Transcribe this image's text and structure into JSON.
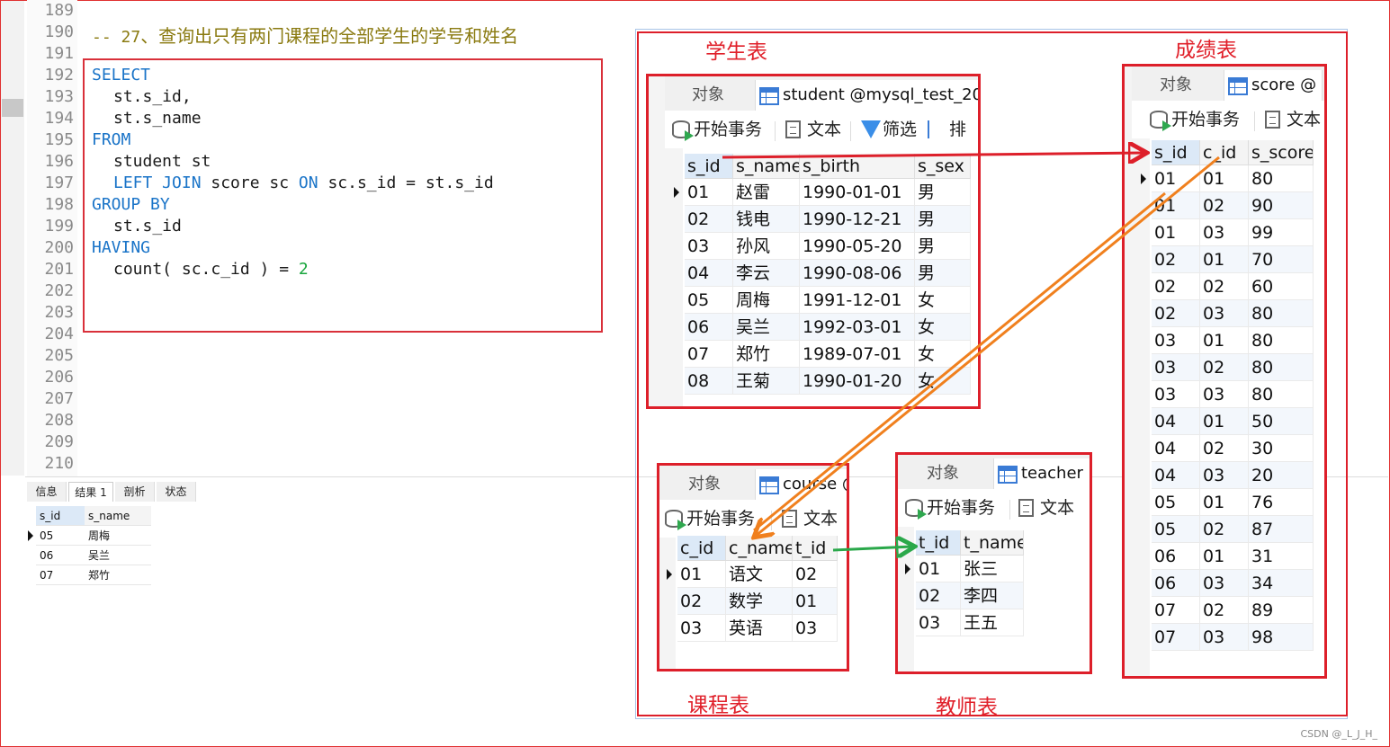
{
  "editor": {
    "line_numbers": [
      "189",
      "190",
      "191",
      "192",
      "193",
      "194",
      "195",
      "196",
      "197",
      "198",
      "199",
      "200",
      "201",
      "202",
      "203",
      "204",
      "205",
      "206",
      "207",
      "208",
      "209",
      "210"
    ],
    "comment_prefix": "-- 27",
    "comment_text": "、查询出只有两门课程的全部学生的学号和姓名",
    "sql": {
      "select": "SELECT",
      "col1": "st.s_id,",
      "col2": "st.s_name",
      "from": "FROM",
      "table": "student st",
      "left_join": "LEFT JOIN",
      "join_table": " score sc ",
      "on": "ON",
      "on_cond": " sc.s_id = st.s_id",
      "group_by": "GROUP BY",
      "group_col": "st.s_id",
      "having": "HAVING",
      "having_expr": "count( sc.c_id ) = ",
      "having_value": "2"
    }
  },
  "results": {
    "tabs": [
      "信息",
      "结果 1",
      "剖析",
      "状态"
    ],
    "active_tab": "结果 1",
    "columns": [
      "s_id",
      "s_name"
    ],
    "rows": [
      [
        "05",
        "周梅"
      ],
      [
        "06",
        "吴兰"
      ],
      [
        "07",
        "郑竹"
      ]
    ]
  },
  "labels": {
    "student": "学生表",
    "score": "成绩表",
    "course": "课程表",
    "teacher": "教师表"
  },
  "common": {
    "objects_tab": "对象",
    "begin_tx": "开始事务",
    "text": "文本",
    "filter": "筛选",
    "sort": "排"
  },
  "student_panel": {
    "tab_title": "student @mysql_test_20",
    "columns": [
      "s_id",
      "s_name",
      "s_birth",
      "s_sex"
    ],
    "rows": [
      [
        "01",
        "赵雷",
        "1990-01-01",
        "男"
      ],
      [
        "02",
        "钱电",
        "1990-12-21",
        "男"
      ],
      [
        "03",
        "孙风",
        "1990-05-20",
        "男"
      ],
      [
        "04",
        "李云",
        "1990-08-06",
        "男"
      ],
      [
        "05",
        "周梅",
        "1991-12-01",
        "女"
      ],
      [
        "06",
        "吴兰",
        "1992-03-01",
        "女"
      ],
      [
        "07",
        "郑竹",
        "1989-07-01",
        "女"
      ],
      [
        "08",
        "王菊",
        "1990-01-20",
        "女"
      ]
    ]
  },
  "score_panel": {
    "tab_title": "score @",
    "columns": [
      "s_id",
      "c_id",
      "s_score"
    ],
    "rows": [
      [
        "01",
        "01",
        "80"
      ],
      [
        "01",
        "02",
        "90"
      ],
      [
        "01",
        "03",
        "99"
      ],
      [
        "02",
        "01",
        "70"
      ],
      [
        "02",
        "02",
        "60"
      ],
      [
        "02",
        "03",
        "80"
      ],
      [
        "03",
        "01",
        "80"
      ],
      [
        "03",
        "02",
        "80"
      ],
      [
        "03",
        "03",
        "80"
      ],
      [
        "04",
        "01",
        "50"
      ],
      [
        "04",
        "02",
        "30"
      ],
      [
        "04",
        "03",
        "20"
      ],
      [
        "05",
        "01",
        "76"
      ],
      [
        "05",
        "02",
        "87"
      ],
      [
        "06",
        "01",
        "31"
      ],
      [
        "06",
        "03",
        "34"
      ],
      [
        "07",
        "02",
        "89"
      ],
      [
        "07",
        "03",
        "98"
      ]
    ]
  },
  "course_panel": {
    "tab_title": "course @",
    "columns": [
      "c_id",
      "c_name",
      "t_id"
    ],
    "rows": [
      [
        "01",
        "语文",
        "02"
      ],
      [
        "02",
        "数学",
        "01"
      ],
      [
        "03",
        "英语",
        "03"
      ]
    ]
  },
  "teacher_panel": {
    "tab_title": "teacher",
    "columns": [
      "t_id",
      "t_name"
    ],
    "rows": [
      [
        "01",
        "张三"
      ],
      [
        "02",
        "李四"
      ],
      [
        "03",
        "王五"
      ]
    ]
  },
  "arrow_colors": {
    "red": "#dd1f2a",
    "orange": "#f0801e",
    "green": "#2aa84a"
  },
  "watermark": "CSDN @_L_J_H_"
}
